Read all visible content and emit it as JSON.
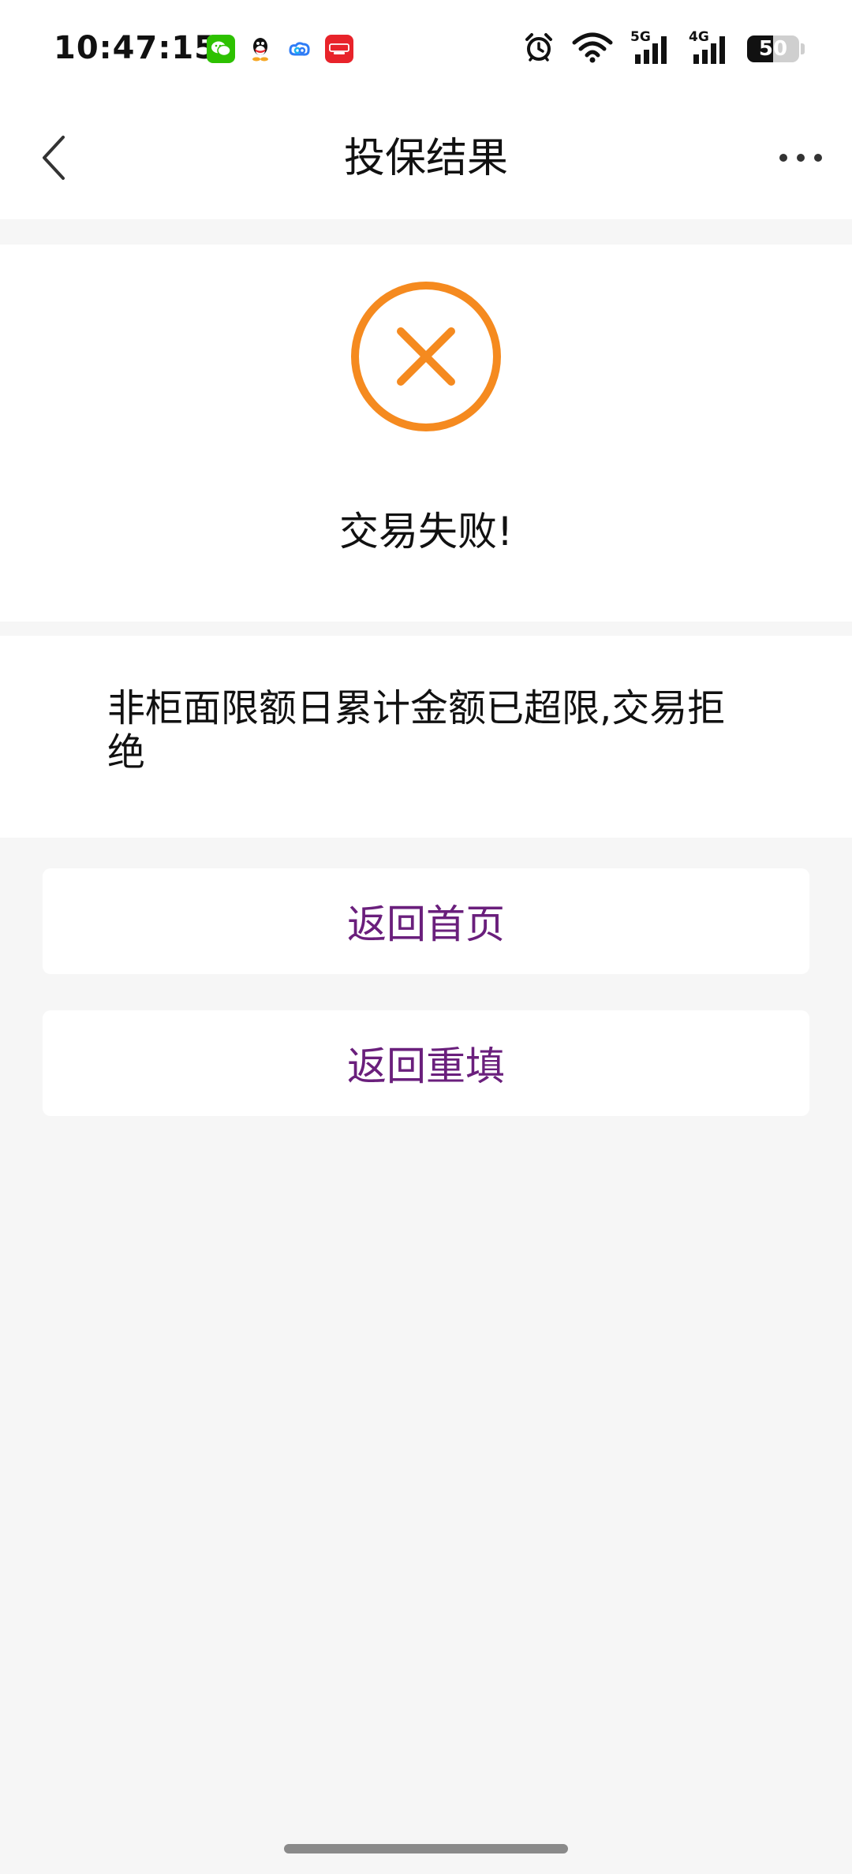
{
  "status_bar": {
    "time": "10:47:15",
    "notification_icons": [
      "wechat-icon",
      "qq-icon",
      "baidu-netdisk-icon",
      "yunshanfu-icon"
    ],
    "system_icons": [
      "alarm-icon",
      "wifi-icon",
      "signal-5g-icon",
      "signal-4g-icon"
    ],
    "signal_5g_label": "5G",
    "signal_4g_label": "4G",
    "battery_level": "50",
    "battery_fraction": 0.5
  },
  "nav": {
    "title": "投保结果",
    "back_icon": "chevron-left-icon",
    "more_icon": "more-horizontal-icon"
  },
  "result": {
    "icon": "fail-circle-x-icon",
    "icon_color": "#f58a1f",
    "message": "交易失败!"
  },
  "detail": {
    "text": "非柜面限额日累计金额已超限,交易拒绝"
  },
  "buttons": {
    "home_label": "返回首页",
    "refill_label": "返回重填",
    "label_color": "#6a1f7c"
  }
}
